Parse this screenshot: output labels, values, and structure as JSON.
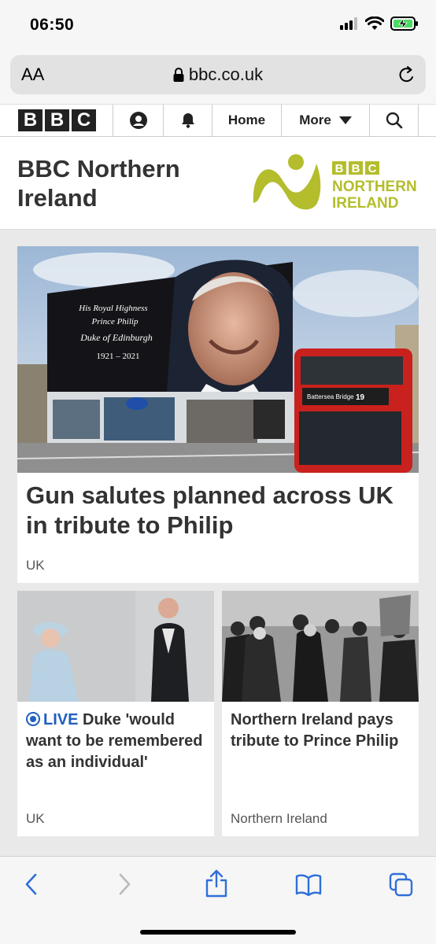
{
  "status_bar": {
    "time": "06:50"
  },
  "browser": {
    "text_size_label": "AA",
    "url": "bbc.co.uk"
  },
  "nav": {
    "logo_letters": [
      "B",
      "B",
      "C"
    ],
    "home_label": "Home",
    "more_label": "More"
  },
  "header": {
    "title": "BBC Northern Ireland",
    "logo_text": [
      "BBC",
      "NORTHERN",
      "IRELAND"
    ]
  },
  "main_story": {
    "image_text": [
      "His Royal Highness",
      "Prince Philip",
      "Duke of Edinburgh",
      "1921 – 2021"
    ],
    "bus_sign": "Battersea Bridge",
    "bus_number": "19",
    "headline": "Gun salutes planned across UK in tribute to Philip",
    "tag": "UK"
  },
  "story_left": {
    "live_label": "LIVE",
    "headline": "Duke 'would want to be remembered as an individual'",
    "tag": "UK"
  },
  "story_right": {
    "headline": "Northern Ireland pays tribute to Prince Philip",
    "tag": "Northern Ireland"
  },
  "colors": {
    "ni_logo": "#b4bd2c",
    "live": "#1f5fbf",
    "bbc_block": "#222222",
    "ios_blue": "#2f6fd8"
  }
}
